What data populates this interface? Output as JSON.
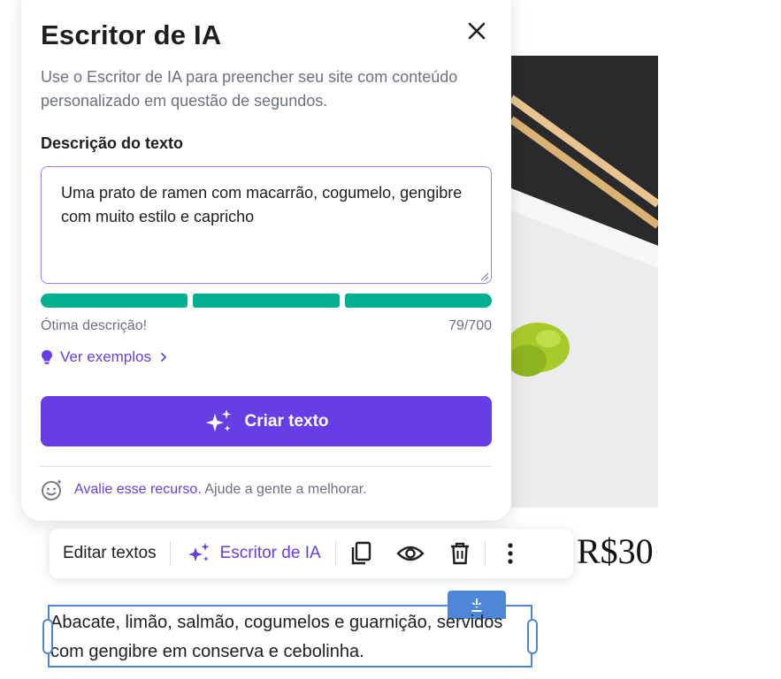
{
  "panel": {
    "title": "Escritor de IA",
    "description": "Use o Escritor de IA para preencher seu site com conteúdo personalizado em questão de segundos.",
    "field_label": "Descrição do texto",
    "textarea_value": "Uma prato de ramen com macarrão, cogumelo, gengibre com muito estilo e capricho",
    "quality_label": "Ótima descrição!",
    "quality_level": 1.0,
    "char_count": "79/700",
    "examples_link": "Ver exemplos",
    "create_button": "Criar texto",
    "feedback_link": "Avalie esse recurso.",
    "feedback_text": "Ajude a gente a melhorar."
  },
  "toolbar": {
    "edit_texts": "Editar textos",
    "ai_writer": "Escritor de IA",
    "icons": [
      "copy-icon",
      "eye-icon",
      "trash-icon",
      "more-vertical-icon"
    ]
  },
  "page": {
    "price": "R$30",
    "selected_text": "Abacate, limão, salmão, cogumelos e guarnição, servidos com gengibre em conserva e cebolinha."
  },
  "colors": {
    "accent": "#673de6",
    "meter": "#00b090",
    "selection": "#4f87d8",
    "muted_text": "#6d7081"
  }
}
